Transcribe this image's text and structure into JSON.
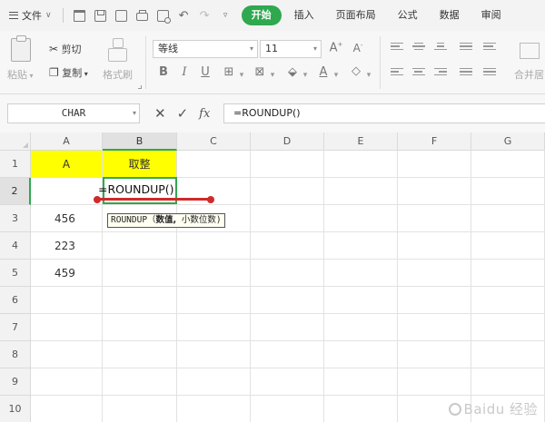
{
  "menu": {
    "file_label": "文件",
    "tabs": [
      {
        "label": "开始",
        "active": true
      },
      {
        "label": "插入",
        "active": false
      },
      {
        "label": "页面布局",
        "active": false
      },
      {
        "label": "公式",
        "active": false
      },
      {
        "label": "数据",
        "active": false
      },
      {
        "label": "审阅",
        "active": false
      }
    ]
  },
  "ribbon": {
    "paste_label": "粘贴",
    "cut_label": "剪切",
    "copy_label": "复制",
    "format_painter_label": "格式刷",
    "font_name": "等线",
    "font_size": "11",
    "merge_label": "合并居"
  },
  "formula_bar": {
    "name_box": "CHAR",
    "cancel_glyph": "✕",
    "confirm_glyph": "✓",
    "fx_label": "fx",
    "formula": "=ROUNDUP()"
  },
  "sheet": {
    "columns": [
      "A",
      "B",
      "C",
      "D",
      "E",
      "F",
      "G"
    ],
    "rows": [
      "1",
      "2",
      "3",
      "4",
      "5",
      "6",
      "7",
      "8",
      "9",
      "10"
    ],
    "cells": {
      "A1": "A",
      "B1": "取整",
      "A3": "456",
      "A4": "223",
      "A5": "459"
    },
    "editing_text": "=ROUNDUP()",
    "tooltip": {
      "func": "ROUNDUP（",
      "arg_bold": "数值,",
      "rest": " 小数位数)"
    },
    "highlight_color": "#ffff00",
    "active_color": "#2fa84f",
    "annotation_color": "#d02a2a"
  },
  "watermark": "Baidu 经验"
}
